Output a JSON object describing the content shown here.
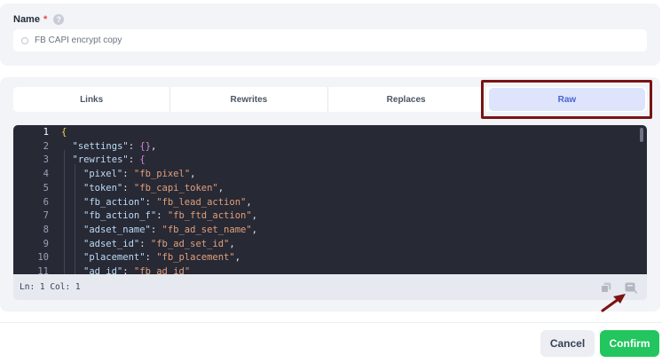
{
  "name_field": {
    "label": "Name",
    "required_mark": "*",
    "help_icon": "question-circle-icon",
    "value": "FB CAPI encrypt copy"
  },
  "tabs": [
    {
      "label": "Links",
      "active": false
    },
    {
      "label": "Rewrites",
      "active": false
    },
    {
      "label": "Replaces",
      "active": false
    },
    {
      "label": "Raw",
      "active": true
    }
  ],
  "editor": {
    "status": "Ln: 1 Col: 1",
    "icons": [
      "copy-icon",
      "format-icon"
    ],
    "lines": [
      {
        "n": "1",
        "indent": 0,
        "parts": [
          {
            "t": "{",
            "c": "b1"
          }
        ]
      },
      {
        "n": "2",
        "indent": 1,
        "parts": [
          {
            "t": "\"settings\"",
            "c": "k"
          },
          {
            "t": ": ",
            "c": ""
          },
          {
            "t": "{}",
            "c": "b2"
          },
          {
            "t": ",",
            "c": ""
          }
        ]
      },
      {
        "n": "3",
        "indent": 1,
        "parts": [
          {
            "t": "\"rewrites\"",
            "c": "k"
          },
          {
            "t": ": ",
            "c": ""
          },
          {
            "t": "{",
            "c": "b2"
          }
        ]
      },
      {
        "n": "4",
        "indent": 2,
        "parts": [
          {
            "t": "\"pixel\"",
            "c": "k"
          },
          {
            "t": ": ",
            "c": ""
          },
          {
            "t": "\"fb_pixel\"",
            "c": "s"
          },
          {
            "t": ",",
            "c": ""
          }
        ]
      },
      {
        "n": "5",
        "indent": 2,
        "parts": [
          {
            "t": "\"token\"",
            "c": "k"
          },
          {
            "t": ": ",
            "c": ""
          },
          {
            "t": "\"fb_capi_token\"",
            "c": "s"
          },
          {
            "t": ",",
            "c": ""
          }
        ]
      },
      {
        "n": "6",
        "indent": 2,
        "parts": [
          {
            "t": "\"fb_action\"",
            "c": "k"
          },
          {
            "t": ": ",
            "c": ""
          },
          {
            "t": "\"fb_lead_action\"",
            "c": "s"
          },
          {
            "t": ",",
            "c": ""
          }
        ]
      },
      {
        "n": "7",
        "indent": 2,
        "parts": [
          {
            "t": "\"fb_action_f\"",
            "c": "k"
          },
          {
            "t": ": ",
            "c": ""
          },
          {
            "t": "\"fb_ftd_action\"",
            "c": "s"
          },
          {
            "t": ",",
            "c": ""
          }
        ]
      },
      {
        "n": "8",
        "indent": 2,
        "parts": [
          {
            "t": "\"adset_name\"",
            "c": "k"
          },
          {
            "t": ": ",
            "c": ""
          },
          {
            "t": "\"fb_ad_set_name\"",
            "c": "s"
          },
          {
            "t": ",",
            "c": ""
          }
        ]
      },
      {
        "n": "9",
        "indent": 2,
        "parts": [
          {
            "t": "\"adset_id\"",
            "c": "k"
          },
          {
            "t": ": ",
            "c": ""
          },
          {
            "t": "\"fb_ad_set_id\"",
            "c": "s"
          },
          {
            "t": ",",
            "c": ""
          }
        ]
      },
      {
        "n": "10",
        "indent": 2,
        "parts": [
          {
            "t": "\"placement\"",
            "c": "k"
          },
          {
            "t": ": ",
            "c": ""
          },
          {
            "t": "\"fb_placement\"",
            "c": "s"
          },
          {
            "t": ",",
            "c": ""
          }
        ]
      },
      {
        "n": "11",
        "indent": 2,
        "parts": [
          {
            "t": "\"ad_id\"",
            "c": "k"
          },
          {
            "t": ": ",
            "c": ""
          },
          {
            "t": "\"fb_ad_id\"",
            "c": "s"
          }
        ]
      }
    ]
  },
  "footer": {
    "cancel_label": "Cancel",
    "confirm_label": "Confirm"
  },
  "colors": {
    "accent": "#4a63d4",
    "confirm": "#22c55e",
    "annotation": "#7a1414",
    "editor_bg": "#272935"
  }
}
